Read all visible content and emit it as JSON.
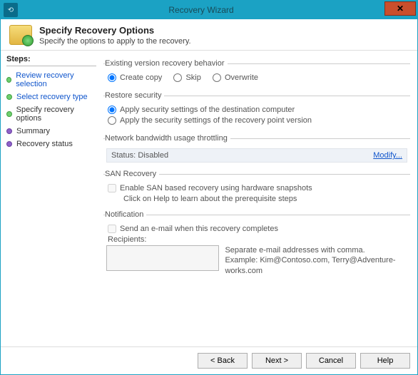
{
  "window": {
    "title": "Recovery Wizard"
  },
  "header": {
    "title": "Specify Recovery Options",
    "subtitle": "Specify the options to apply to the recovery."
  },
  "steps": {
    "heading": "Steps:",
    "items": [
      {
        "label": "Review recovery selection",
        "link": true,
        "state": "done"
      },
      {
        "label": "Select recovery type",
        "link": true,
        "state": "done"
      },
      {
        "label": "Specify recovery options",
        "link": false,
        "state": "current"
      },
      {
        "label": "Summary",
        "link": false,
        "state": "pending"
      },
      {
        "label": "Recovery status",
        "link": false,
        "state": "pending"
      }
    ]
  },
  "options": {
    "existing": {
      "legend": "Existing version recovery behavior",
      "create_copy": "Create copy",
      "skip": "Skip",
      "overwrite": "Overwrite"
    },
    "security": {
      "legend": "Restore security",
      "dest": "Apply security settings of the destination computer",
      "point": "Apply the security settings of the recovery point version"
    },
    "throttle": {
      "legend": "Network bandwidth usage throttling",
      "status_label": "Status:",
      "status_value": "Disabled",
      "modify": "Modify..."
    },
    "san": {
      "legend": "SAN Recovery",
      "enable": "Enable SAN based recovery using hardware snapshots",
      "note": "Click on Help to learn about the prerequisite steps"
    },
    "notify": {
      "legend": "Notification",
      "send": "Send an e-mail when this recovery completes",
      "recipients_label": "Recipients:",
      "help1": "Separate e-mail addresses with comma.",
      "help2": "Example: Kim@Contoso.com, Terry@Adventure-works.com"
    }
  },
  "buttons": {
    "back": "< Back",
    "next": "Next >",
    "cancel": "Cancel",
    "help": "Help"
  }
}
